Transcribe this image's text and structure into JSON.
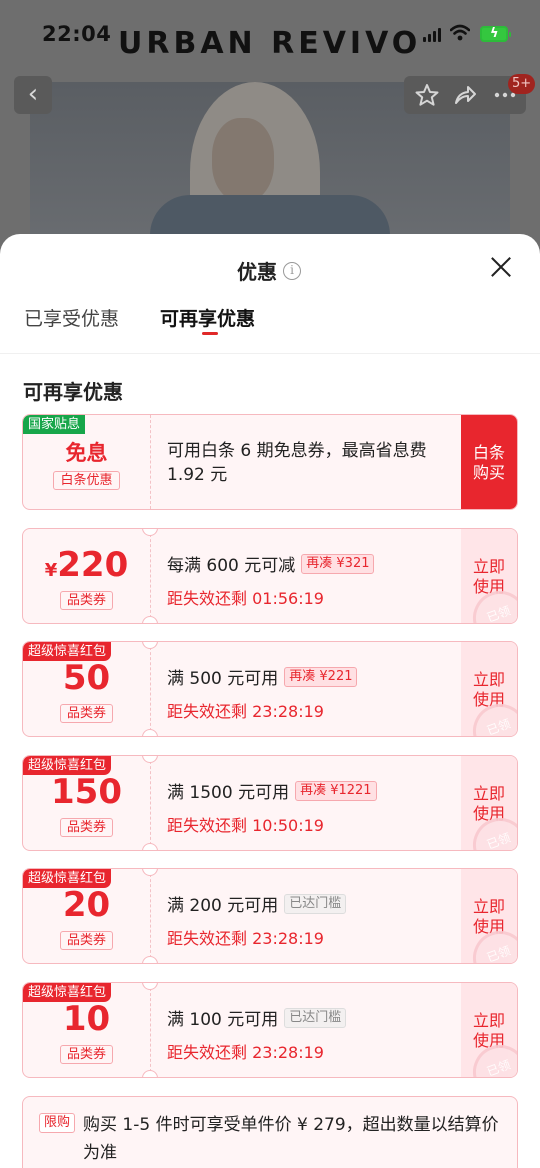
{
  "status_bar": {
    "time": "22:04",
    "battery_icon": "battery-charging-icon"
  },
  "background": {
    "brand": "URBAN REVIVO",
    "badge": "5+"
  },
  "sheet": {
    "title": "优惠",
    "tabs": [
      {
        "label": "已享受优惠",
        "active": false
      },
      {
        "label": "可再享优惠",
        "active": true
      }
    ],
    "section_title": "可再享优惠"
  },
  "first_coupon": {
    "corner_tag": "国家贴息",
    "main": "免息",
    "sub_tag": "白条优惠",
    "description": "可用白条 6 期免息券，最高省息费 1.92 元",
    "action": "白条购买"
  },
  "coupons": [
    {
      "corner_tag": "",
      "currency": "¥",
      "value": "220",
      "sub_tag": "品类券",
      "condition": "每满 600 元可减",
      "pill": "再凑 ¥321",
      "pill_style": "red",
      "countdown": "距失效还剩 01:56:19",
      "action": "立即使用",
      "stamp": "已领"
    },
    {
      "corner_tag": "超级惊喜红包",
      "currency": "",
      "value": "50",
      "sub_tag": "品类券",
      "condition": "满 500 元可用",
      "pill": "再凑 ¥221",
      "pill_style": "red",
      "countdown": "距失效还剩 23:28:19",
      "action": "立即使用",
      "stamp": "已领"
    },
    {
      "corner_tag": "超级惊喜红包",
      "currency": "",
      "value": "150",
      "sub_tag": "品类券",
      "condition": "满 1500 元可用",
      "pill": "再凑 ¥1221",
      "pill_style": "red",
      "countdown": "距失效还剩 10:50:19",
      "action": "立即使用",
      "stamp": "已领"
    },
    {
      "corner_tag": "超级惊喜红包",
      "currency": "",
      "value": "20",
      "sub_tag": "品类券",
      "condition": "满 200 元可用",
      "pill": "已达门槛",
      "pill_style": "grey",
      "countdown": "距失效还剩 23:28:19",
      "action": "立即使用",
      "stamp": "已领"
    },
    {
      "corner_tag": "超级惊喜红包",
      "currency": "",
      "value": "10",
      "sub_tag": "品类券",
      "condition": "满 100 元可用",
      "pill": "已达门槛",
      "pill_style": "grey",
      "countdown": "距失效还剩 23:28:19",
      "action": "立即使用",
      "stamp": "已领"
    }
  ],
  "limit_notice": {
    "tag": "限购",
    "text": "购买 1-5 件时可享受单件价 ¥ 279，超出数量以结算价为准"
  },
  "colors": {
    "accent": "#e8262e",
    "coupon_bg": "#fff5f6",
    "green_tag": "#17a64a"
  }
}
